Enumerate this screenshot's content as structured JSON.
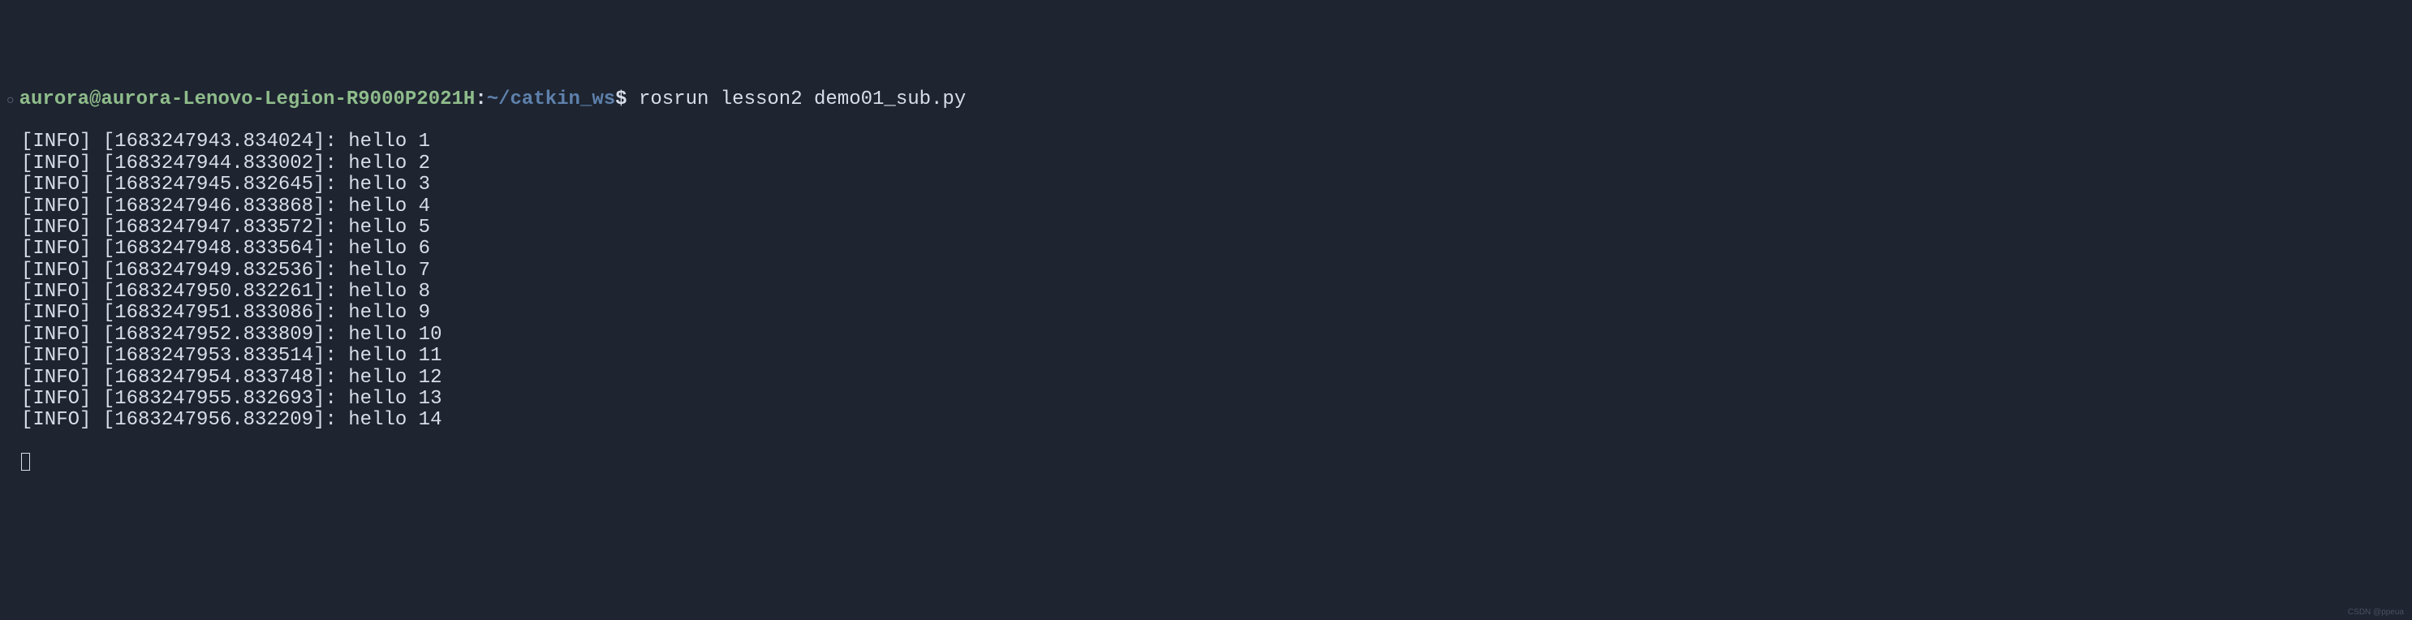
{
  "prompt": {
    "user_host": "aurora@aurora-Lenovo-Legion-R9000P2021H",
    "colon": ":",
    "path": "~/catkin_ws",
    "dollar": "$",
    "command": " rosrun lesson2 demo01_sub.py"
  },
  "logs": [
    {
      "level": "[INFO]",
      "timestamp": "[1683247943.834024]",
      "message": "hello 1"
    },
    {
      "level": "[INFO]",
      "timestamp": "[1683247944.833002]",
      "message": "hello 2"
    },
    {
      "level": "[INFO]",
      "timestamp": "[1683247945.832645]",
      "message": "hello 3"
    },
    {
      "level": "[INFO]",
      "timestamp": "[1683247946.833868]",
      "message": "hello 4"
    },
    {
      "level": "[INFO]",
      "timestamp": "[1683247947.833572]",
      "message": "hello 5"
    },
    {
      "level": "[INFO]",
      "timestamp": "[1683247948.833564]",
      "message": "hello 6"
    },
    {
      "level": "[INFO]",
      "timestamp": "[1683247949.832536]",
      "message": "hello 7"
    },
    {
      "level": "[INFO]",
      "timestamp": "[1683247950.832261]",
      "message": "hello 8"
    },
    {
      "level": "[INFO]",
      "timestamp": "[1683247951.833086]",
      "message": "hello 9"
    },
    {
      "level": "[INFO]",
      "timestamp": "[1683247952.833809]",
      "message": "hello 10"
    },
    {
      "level": "[INFO]",
      "timestamp": "[1683247953.833514]",
      "message": "hello 11"
    },
    {
      "level": "[INFO]",
      "timestamp": "[1683247954.833748]",
      "message": "hello 12"
    },
    {
      "level": "[INFO]",
      "timestamp": "[1683247955.832693]",
      "message": "hello 13"
    },
    {
      "level": "[INFO]",
      "timestamp": "[1683247956.832209]",
      "message": "hello 14"
    }
  ],
  "watermark": "CSDN @ppeua"
}
